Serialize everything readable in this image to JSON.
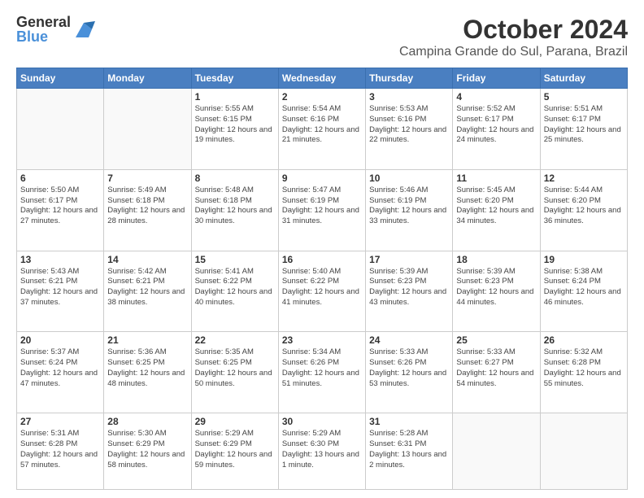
{
  "header": {
    "logo_general": "General",
    "logo_blue": "Blue",
    "month_title": "October 2024",
    "location": "Campina Grande do Sul, Parana, Brazil"
  },
  "weekdays": [
    "Sunday",
    "Monday",
    "Tuesday",
    "Wednesday",
    "Thursday",
    "Friday",
    "Saturday"
  ],
  "weeks": [
    [
      {
        "day": "",
        "info": ""
      },
      {
        "day": "",
        "info": ""
      },
      {
        "day": "1",
        "info": "Sunrise: 5:55 AM\nSunset: 6:15 PM\nDaylight: 12 hours and 19 minutes."
      },
      {
        "day": "2",
        "info": "Sunrise: 5:54 AM\nSunset: 6:16 PM\nDaylight: 12 hours and 21 minutes."
      },
      {
        "day": "3",
        "info": "Sunrise: 5:53 AM\nSunset: 6:16 PM\nDaylight: 12 hours and 22 minutes."
      },
      {
        "day": "4",
        "info": "Sunrise: 5:52 AM\nSunset: 6:17 PM\nDaylight: 12 hours and 24 minutes."
      },
      {
        "day": "5",
        "info": "Sunrise: 5:51 AM\nSunset: 6:17 PM\nDaylight: 12 hours and 25 minutes."
      }
    ],
    [
      {
        "day": "6",
        "info": "Sunrise: 5:50 AM\nSunset: 6:17 PM\nDaylight: 12 hours and 27 minutes."
      },
      {
        "day": "7",
        "info": "Sunrise: 5:49 AM\nSunset: 6:18 PM\nDaylight: 12 hours and 28 minutes."
      },
      {
        "day": "8",
        "info": "Sunrise: 5:48 AM\nSunset: 6:18 PM\nDaylight: 12 hours and 30 minutes."
      },
      {
        "day": "9",
        "info": "Sunrise: 5:47 AM\nSunset: 6:19 PM\nDaylight: 12 hours and 31 minutes."
      },
      {
        "day": "10",
        "info": "Sunrise: 5:46 AM\nSunset: 6:19 PM\nDaylight: 12 hours and 33 minutes."
      },
      {
        "day": "11",
        "info": "Sunrise: 5:45 AM\nSunset: 6:20 PM\nDaylight: 12 hours and 34 minutes."
      },
      {
        "day": "12",
        "info": "Sunrise: 5:44 AM\nSunset: 6:20 PM\nDaylight: 12 hours and 36 minutes."
      }
    ],
    [
      {
        "day": "13",
        "info": "Sunrise: 5:43 AM\nSunset: 6:21 PM\nDaylight: 12 hours and 37 minutes."
      },
      {
        "day": "14",
        "info": "Sunrise: 5:42 AM\nSunset: 6:21 PM\nDaylight: 12 hours and 38 minutes."
      },
      {
        "day": "15",
        "info": "Sunrise: 5:41 AM\nSunset: 6:22 PM\nDaylight: 12 hours and 40 minutes."
      },
      {
        "day": "16",
        "info": "Sunrise: 5:40 AM\nSunset: 6:22 PM\nDaylight: 12 hours and 41 minutes."
      },
      {
        "day": "17",
        "info": "Sunrise: 5:39 AM\nSunset: 6:23 PM\nDaylight: 12 hours and 43 minutes."
      },
      {
        "day": "18",
        "info": "Sunrise: 5:39 AM\nSunset: 6:23 PM\nDaylight: 12 hours and 44 minutes."
      },
      {
        "day": "19",
        "info": "Sunrise: 5:38 AM\nSunset: 6:24 PM\nDaylight: 12 hours and 46 minutes."
      }
    ],
    [
      {
        "day": "20",
        "info": "Sunrise: 5:37 AM\nSunset: 6:24 PM\nDaylight: 12 hours and 47 minutes."
      },
      {
        "day": "21",
        "info": "Sunrise: 5:36 AM\nSunset: 6:25 PM\nDaylight: 12 hours and 48 minutes."
      },
      {
        "day": "22",
        "info": "Sunrise: 5:35 AM\nSunset: 6:25 PM\nDaylight: 12 hours and 50 minutes."
      },
      {
        "day": "23",
        "info": "Sunrise: 5:34 AM\nSunset: 6:26 PM\nDaylight: 12 hours and 51 minutes."
      },
      {
        "day": "24",
        "info": "Sunrise: 5:33 AM\nSunset: 6:26 PM\nDaylight: 12 hours and 53 minutes."
      },
      {
        "day": "25",
        "info": "Sunrise: 5:33 AM\nSunset: 6:27 PM\nDaylight: 12 hours and 54 minutes."
      },
      {
        "day": "26",
        "info": "Sunrise: 5:32 AM\nSunset: 6:28 PM\nDaylight: 12 hours and 55 minutes."
      }
    ],
    [
      {
        "day": "27",
        "info": "Sunrise: 5:31 AM\nSunset: 6:28 PM\nDaylight: 12 hours and 57 minutes."
      },
      {
        "day": "28",
        "info": "Sunrise: 5:30 AM\nSunset: 6:29 PM\nDaylight: 12 hours and 58 minutes."
      },
      {
        "day": "29",
        "info": "Sunrise: 5:29 AM\nSunset: 6:29 PM\nDaylight: 12 hours and 59 minutes."
      },
      {
        "day": "30",
        "info": "Sunrise: 5:29 AM\nSunset: 6:30 PM\nDaylight: 13 hours and 1 minute."
      },
      {
        "day": "31",
        "info": "Sunrise: 5:28 AM\nSunset: 6:31 PM\nDaylight: 13 hours and 2 minutes."
      },
      {
        "day": "",
        "info": ""
      },
      {
        "day": "",
        "info": ""
      }
    ]
  ]
}
